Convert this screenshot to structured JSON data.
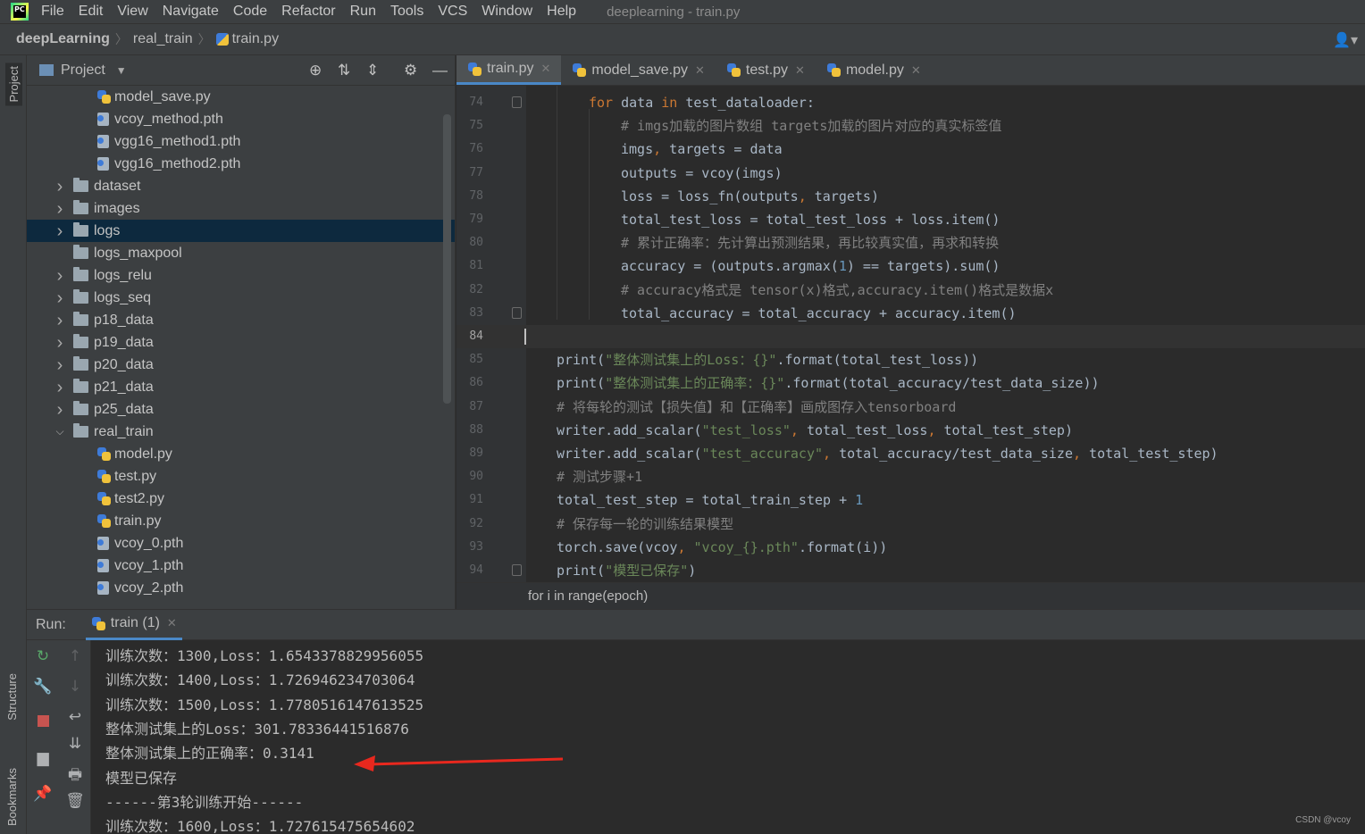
{
  "menubar": {
    "logo_text": "PC",
    "items": [
      "File",
      "Edit",
      "View",
      "Navigate",
      "Code",
      "Refactor",
      "Run",
      "Tools",
      "VCS",
      "Window",
      "Help"
    ],
    "window_title": "deeplearning - train.py"
  },
  "navbar": {
    "crumbs": [
      "deepLearning",
      "real_train",
      "train.py"
    ]
  },
  "toolstrip": {
    "project": "Project",
    "structure": "Structure",
    "bookmarks": "Bookmarks"
  },
  "project_panel": {
    "title": "Project",
    "items": [
      {
        "label": "model_save.py",
        "type": "py",
        "depth": 2
      },
      {
        "label": "vcoy_method.pth",
        "type": "pth",
        "depth": 2
      },
      {
        "label": "vgg16_method1.pth",
        "type": "pth",
        "depth": 2
      },
      {
        "label": "vgg16_method2.pth",
        "type": "pth",
        "depth": 2
      },
      {
        "label": "dataset",
        "type": "dir",
        "depth": 1,
        "expandable": true
      },
      {
        "label": "images",
        "type": "dir",
        "depth": 1,
        "expandable": true
      },
      {
        "label": "logs",
        "type": "dir",
        "depth": 1,
        "expandable": true,
        "selected": true
      },
      {
        "label": "logs_maxpool",
        "type": "dir",
        "depth": 1,
        "expandable": false
      },
      {
        "label": "logs_relu",
        "type": "dir",
        "depth": 1,
        "expandable": true
      },
      {
        "label": "logs_seq",
        "type": "dir",
        "depth": 1,
        "expandable": true
      },
      {
        "label": "p18_data",
        "type": "dir",
        "depth": 1,
        "expandable": true
      },
      {
        "label": "p19_data",
        "type": "dir",
        "depth": 1,
        "expandable": true
      },
      {
        "label": "p20_data",
        "type": "dir",
        "depth": 1,
        "expandable": true
      },
      {
        "label": "p21_data",
        "type": "dir",
        "depth": 1,
        "expandable": true
      },
      {
        "label": "p25_data",
        "type": "dir",
        "depth": 1,
        "expandable": true
      },
      {
        "label": "real_train",
        "type": "dir",
        "depth": 1,
        "expandable": true,
        "expanded": true
      },
      {
        "label": "model.py",
        "type": "py",
        "depth": 2
      },
      {
        "label": "test.py",
        "type": "py",
        "depth": 2
      },
      {
        "label": "test2.py",
        "type": "py",
        "depth": 2
      },
      {
        "label": "train.py",
        "type": "py",
        "depth": 2
      },
      {
        "label": "vcoy_0.pth",
        "type": "pth",
        "depth": 2
      },
      {
        "label": "vcoy_1.pth",
        "type": "pth",
        "depth": 2
      },
      {
        "label": "vcoy_2.pth",
        "type": "pth",
        "depth": 2
      }
    ]
  },
  "editor": {
    "tabs": [
      {
        "label": "train.py",
        "active": true
      },
      {
        "label": "model_save.py",
        "active": false
      },
      {
        "label": "test.py",
        "active": false
      },
      {
        "label": "model.py",
        "active": false
      }
    ],
    "current_line": "84",
    "lines": [
      {
        "num": "74",
        "text": "for data in test_dataloader:",
        "indent": 2
      },
      {
        "num": "75",
        "text": "# imgs加载的图片数组 targets加载的图片对应的真实标签值",
        "indent": 3
      },
      {
        "num": "76",
        "text": "imgs, targets = data",
        "indent": 3
      },
      {
        "num": "77",
        "text": "outputs = vcoy(imgs)",
        "indent": 3
      },
      {
        "num": "78",
        "text": "loss = loss_fn(outputs, targets)",
        "indent": 3
      },
      {
        "num": "79",
        "text": "total_test_loss = total_test_loss + loss.item()",
        "indent": 3
      },
      {
        "num": "80",
        "text": "# 累计正确率：先计算出预测结果，再比较真实值，再求和转换",
        "indent": 3
      },
      {
        "num": "81",
        "text": "accuracy = (outputs.argmax(1) == targets).sum()",
        "indent": 3
      },
      {
        "num": "82",
        "text": "# accuracy格式是 tensor(x)格式,accuracy.item()格式是数据x",
        "indent": 3
      },
      {
        "num": "83",
        "text": "total_accuracy = total_accuracy + accuracy.item()",
        "indent": 3
      },
      {
        "num": "84",
        "text": "",
        "indent": 0
      },
      {
        "num": "85",
        "text": "print(\"整体测试集上的Loss：{}\".format(total_test_loss))",
        "indent": 1
      },
      {
        "num": "86",
        "text": "print(\"整体测试集上的正确率：{}\".format(total_accuracy/test_data_size))",
        "indent": 1
      },
      {
        "num": "87",
        "text": "# 将每轮的测试【损失值】和【正确率】画成图存入tensorboard",
        "indent": 1
      },
      {
        "num": "88",
        "text": "writer.add_scalar(\"test_loss\", total_test_loss, total_test_step)",
        "indent": 1
      },
      {
        "num": "89",
        "text": "writer.add_scalar(\"test_accuracy\", total_accuracy/test_data_size, total_test_step)",
        "indent": 1
      },
      {
        "num": "90",
        "text": "# 测试步骤+1",
        "indent": 1
      },
      {
        "num": "91",
        "text": "total_test_step = total_train_step + 1",
        "indent": 1
      },
      {
        "num": "92",
        "text": "# 保存每一轮的训练结果模型",
        "indent": 1
      },
      {
        "num": "93",
        "text": "torch.save(vcoy, \"vcoy_{}.pth\".format(i))",
        "indent": 1
      },
      {
        "num": "94",
        "text": "print(\"模型已保存\")",
        "indent": 1
      }
    ],
    "bottom_breadcrumb": "for i in range(epoch)"
  },
  "run_panel": {
    "label": "Run:",
    "tab": "train (1)",
    "console_lines": [
      "训练次数：1300,Loss：1.6543378829956055",
      "训练次数：1400,Loss：1.726946234703064",
      "训练次数：1500,Loss：1.7780516147613525",
      "整体测试集上的Loss：301.78336441516876",
      "整体测试集上的正确率：0.3141",
      "模型已保存",
      "------第3轮训练开始------",
      "训练次数：1600,Loss：1.727615475654602"
    ]
  },
  "watermark": "CSDN @vcoy",
  "colors": {
    "keyword": "#cc7832",
    "string": "#6a8759",
    "comment": "#808080",
    "number": "#6897bb",
    "text": "#a9b7c6",
    "accent": "#4a88c7",
    "arrow": "#e8281e"
  }
}
